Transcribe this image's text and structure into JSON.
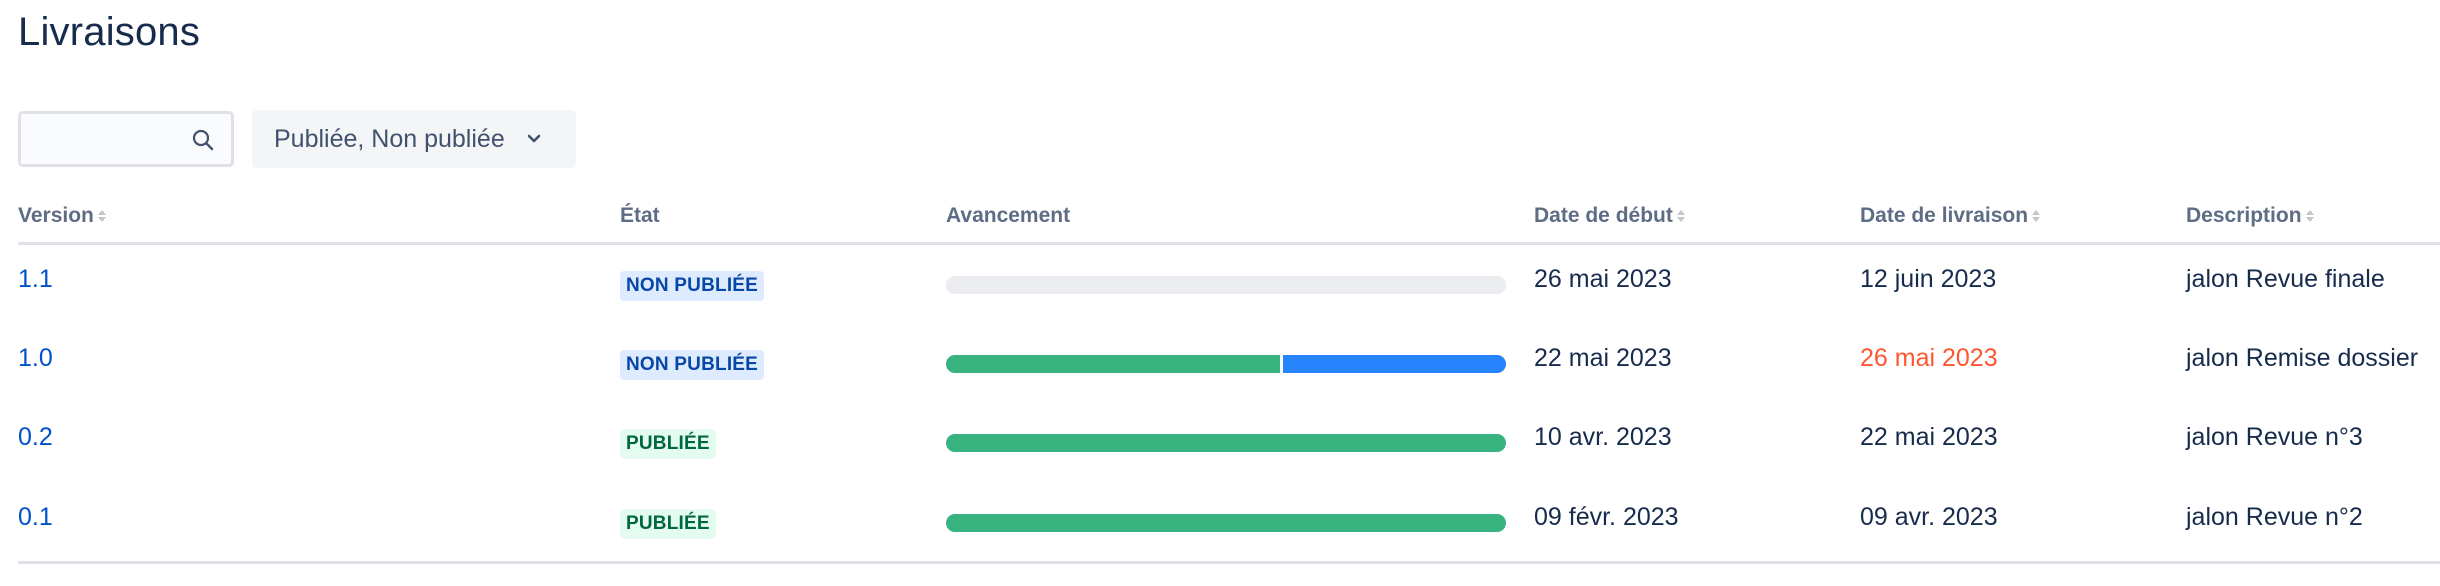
{
  "page": {
    "title": "Livraisons"
  },
  "search": {
    "value": "",
    "placeholder": "",
    "icon": "search-icon"
  },
  "filter": {
    "label": "Publiée, Non publiée",
    "icon": "chevron-down-icon"
  },
  "table": {
    "columns": {
      "version": "Version",
      "status": "État",
      "progress": "Avancement",
      "start_date": "Date de début",
      "release_date": "Date de livraison",
      "description": "Description"
    },
    "rows": [
      {
        "version": "1.1",
        "status": "NON PUBLIÉE",
        "status_kind": "unreleased",
        "progress_done": 0,
        "progress_in_progress": 0,
        "start_date": "26 mai 2023",
        "release_date": "12 juin 2023",
        "release_late": false,
        "description": "jalon Revue finale"
      },
      {
        "version": "1.0",
        "status": "NON PUBLIÉE",
        "status_kind": "unreleased",
        "progress_done": 0.6,
        "progress_in_progress": 0.4,
        "start_date": "22 mai 2023",
        "release_date": "26 mai 2023",
        "release_late": true,
        "description": "jalon Remise dossier"
      },
      {
        "version": "0.2",
        "status": "PUBLIÉE",
        "status_kind": "released",
        "progress_done": 1,
        "progress_in_progress": 0,
        "start_date": "10 avr. 2023",
        "release_date": "22 mai 2023",
        "release_late": false,
        "description": "jalon Revue n°3"
      },
      {
        "version": "0.1",
        "status": "PUBLIÉE",
        "status_kind": "released",
        "progress_done": 1,
        "progress_in_progress": 0,
        "start_date": "09 févr. 2023",
        "release_date": "09 avr. 2023",
        "release_late": false,
        "description": "jalon Revue n°2"
      }
    ]
  },
  "colors": {
    "link": "#0052cc",
    "done": "#36b37e",
    "in_progress": "#2684ff",
    "late": "#ff5630",
    "unreleased_bg": "#deebff",
    "released_bg": "#e3fcef"
  }
}
